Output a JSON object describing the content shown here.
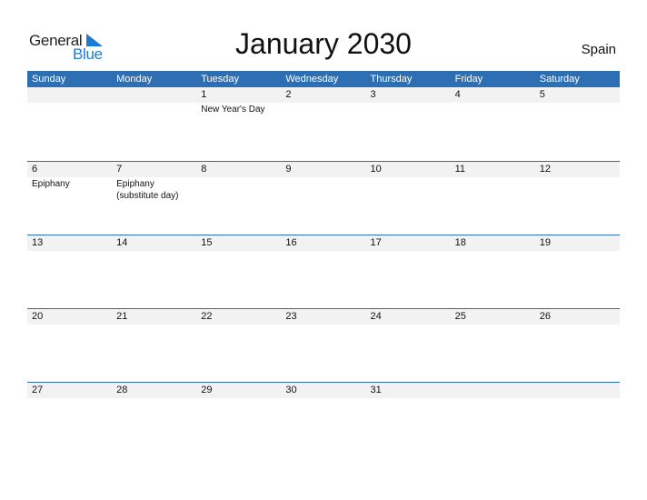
{
  "logo": {
    "line1": "General",
    "line2": "Blue"
  },
  "title": "January 2030",
  "country": "Spain",
  "colors": {
    "accent": "#2e6fb3",
    "strip": "#f2f2f2",
    "logo_blue": "#1f7ad1"
  },
  "weekdays": [
    "Sunday",
    "Monday",
    "Tuesday",
    "Wednesday",
    "Thursday",
    "Friday",
    "Saturday"
  ],
  "weeks": [
    {
      "dates": [
        "",
        "",
        "1",
        "2",
        "3",
        "4",
        "5"
      ],
      "events": [
        "",
        "",
        "New Year's Day",
        "",
        "",
        "",
        ""
      ]
    },
    {
      "dates": [
        "6",
        "7",
        "8",
        "9",
        "10",
        "11",
        "12"
      ],
      "events": [
        "Epiphany",
        "Epiphany (substitute day)",
        "",
        "",
        "",
        "",
        ""
      ]
    },
    {
      "dates": [
        "13",
        "14",
        "15",
        "16",
        "17",
        "18",
        "19"
      ],
      "events": [
        "",
        "",
        "",
        "",
        "",
        "",
        ""
      ]
    },
    {
      "dates": [
        "20",
        "21",
        "22",
        "23",
        "24",
        "25",
        "26"
      ],
      "events": [
        "",
        "",
        "",
        "",
        "",
        "",
        ""
      ]
    },
    {
      "dates": [
        "27",
        "28",
        "29",
        "30",
        "31",
        "",
        ""
      ],
      "events": [
        "",
        "",
        "",
        "",
        "",
        "",
        ""
      ]
    }
  ]
}
